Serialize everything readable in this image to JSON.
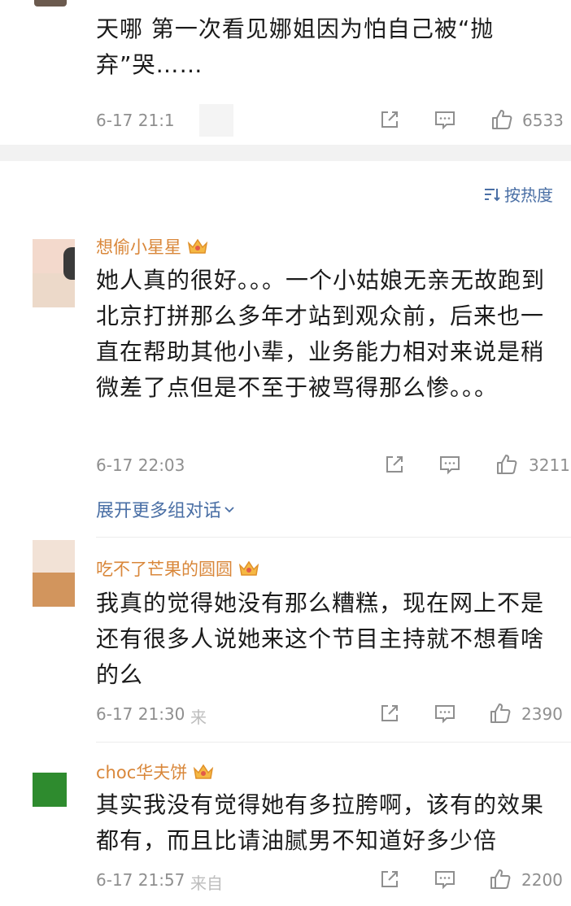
{
  "top_comment": {
    "text": "天哪 第一次看见娜姐因为怕自己被“抛弃”哭……",
    "time": "6-17 21:1",
    "likes": "6533"
  },
  "sort": {
    "label": "按热度",
    "icon": "sort-icon"
  },
  "comments": [
    {
      "username": "想偷小星星",
      "text": "她人真的很好。。。一个小姑娘无亲无故跑到北京打拼那么多年才站到观众前，后来也一直在帮助其他小辈，业务能力相对来说是稍微差了点但是不至于被骂得那么惨。。。",
      "time": "6-17 22:03",
      "source": "",
      "likes": "3211",
      "expand_label": "展开更多组对话"
    },
    {
      "username": "吃不了芒果的圆圆",
      "text": "我真的觉得她没有那么糟糕，现在网上不是还有很多人说她来这个节目主持就不想看啥的么",
      "time": "6-17 21:30",
      "source": "来",
      "likes": "2390"
    },
    {
      "username": "choc华夫饼",
      "text": "其实我没有觉得她有多拉胯啊，该有的效果都有，而且比请油腻男不知道好多少倍",
      "time": "6-17 21:57",
      "source": "来自",
      "likes": "2200"
    }
  ],
  "colors": {
    "username": "#d9873a",
    "link": "#4a6fa5",
    "meta": "#8f8f8f",
    "section_gap": "#f2f2f2"
  },
  "icons": [
    "share-icon",
    "comment-icon",
    "like-icon",
    "crown-badge-icon"
  ]
}
